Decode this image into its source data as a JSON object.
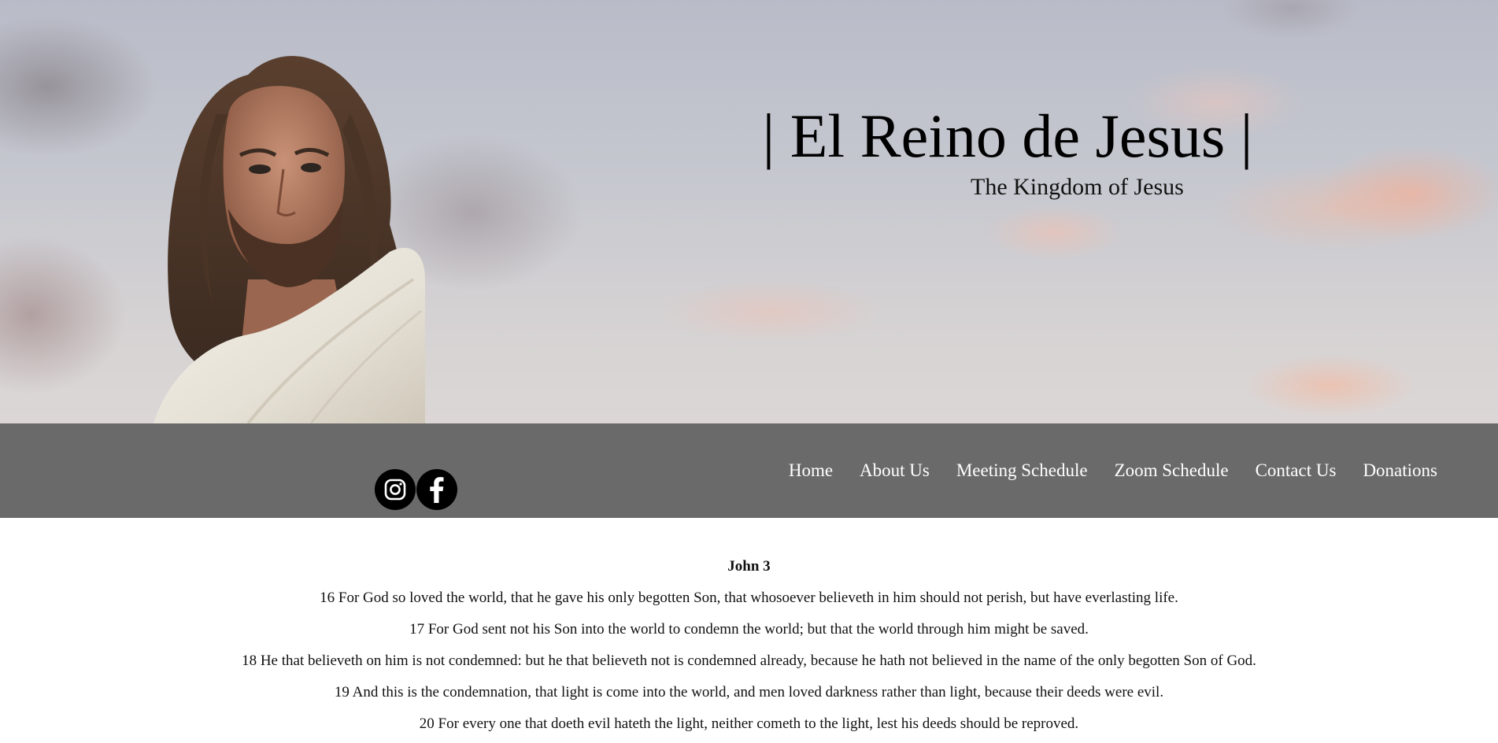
{
  "header": {
    "title": "| El Reino de Jesus |",
    "subtitle": "The Kingdom of Jesus"
  },
  "social": {
    "instagram_icon": "instagram-icon",
    "facebook_icon": "facebook-icon"
  },
  "nav": {
    "items": [
      {
        "label": "Home"
      },
      {
        "label": "About Us"
      },
      {
        "label": "Meeting Schedule"
      },
      {
        "label": "Zoom Schedule"
      },
      {
        "label": "Contact Us"
      },
      {
        "label": "Donations"
      }
    ]
  },
  "scripture": {
    "chapter": "John 3",
    "verses": [
      "16 For God so loved the world, that he gave his only begotten Son, that whosoever believeth in him should not perish, but have everlasting life.",
      "17 For God sent not his Son into the world to condemn the world; but that the world through him might be saved.",
      "18 He that believeth on him is not condemned: but he that believeth not is condemned already, because he hath not believed in the name of the only begotten Son of God.",
      "19 And this is the condemnation, that light is come into the world, and men loved darkness rather than light, because their deeds were evil.",
      "20 For every one that doeth evil hateth the light, neither cometh to the light, lest his deeds should be reproved."
    ]
  },
  "colors": {
    "navbar": "#6a6a6a",
    "nav_text": "#ffffff",
    "social_icon_bg": "#000000"
  }
}
